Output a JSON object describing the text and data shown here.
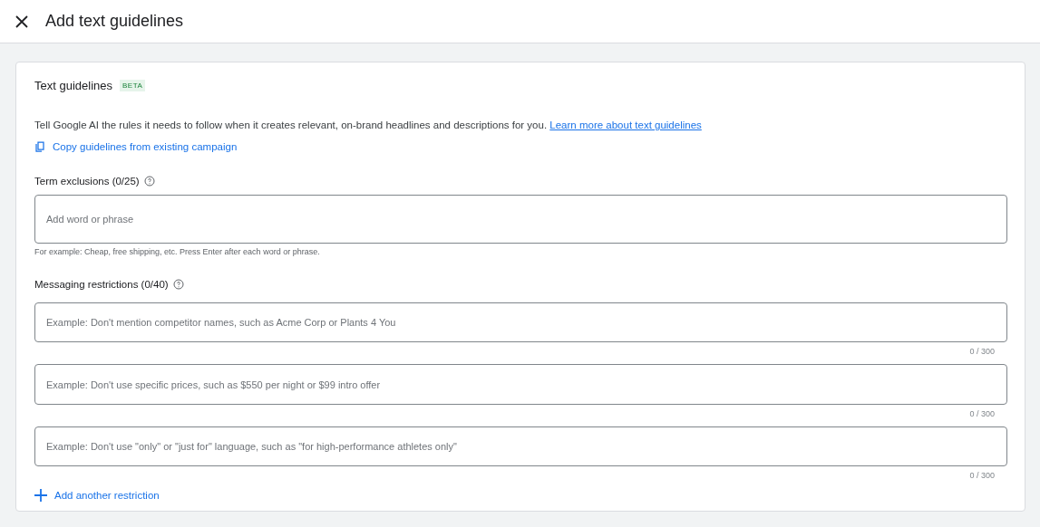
{
  "header": {
    "title": "Add text guidelines"
  },
  "card": {
    "title": "Text guidelines",
    "badge": "BETA",
    "description": "Tell Google AI the rules it needs to follow when it creates relevant, on-brand headlines and descriptions for you.",
    "learn_more_link": "Learn more about text guidelines",
    "copy_link": "Copy guidelines from existing campaign"
  },
  "term_exclusions": {
    "label": "Term exclusions (0/25)",
    "placeholder": "Add word or phrase",
    "helper": "For example: Cheap, free shipping, etc. Press Enter after each word or phrase."
  },
  "messaging_restrictions": {
    "label": "Messaging restrictions (0/40)",
    "fields": [
      {
        "placeholder": "Example: Don't mention competitor names, such as Acme Corp or Plants 4 You",
        "counter": "0 / 300"
      },
      {
        "placeholder": "Example: Don't use specific prices, such as $550 per night or $99 intro offer",
        "counter": "0 / 300"
      },
      {
        "placeholder": "Example: Don't use \"only\" or \"just for\" language, such as \"for high-performance athletes only\"",
        "counter": "0 / 300"
      }
    ],
    "add_link": "Add another restriction"
  }
}
